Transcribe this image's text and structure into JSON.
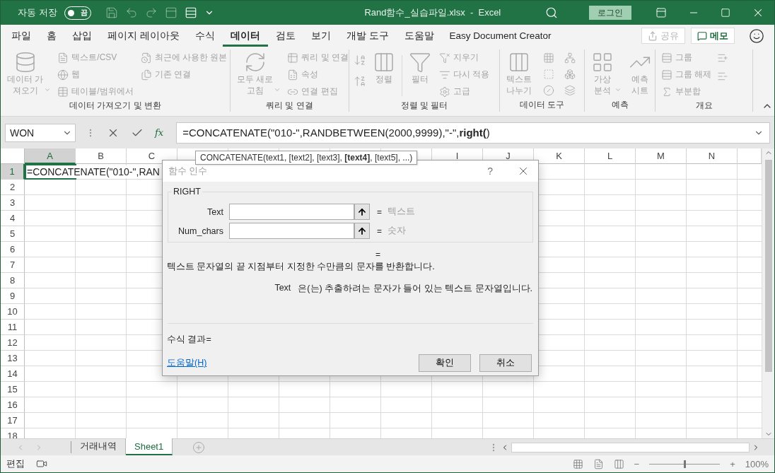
{
  "title_bar": {
    "autosave_label": "자동 저장",
    "autosave_toggle": {
      "on": false,
      "label": "끔"
    },
    "title": "Rand함수_실습파일.xlsx  -  Excel",
    "sign_in": "로그인"
  },
  "ribbon_tabs": [
    {
      "label": "파일",
      "selected": false
    },
    {
      "label": "홈",
      "selected": false
    },
    {
      "label": "삽입",
      "selected": false
    },
    {
      "label": "페이지 레이아웃",
      "selected": false
    },
    {
      "label": "수식",
      "selected": false
    },
    {
      "label": "데이터",
      "selected": true
    },
    {
      "label": "검토",
      "selected": false
    },
    {
      "label": "보기",
      "selected": false
    },
    {
      "label": "개발 도구",
      "selected": false
    },
    {
      "label": "도움말",
      "selected": false
    },
    {
      "label": "Easy Document Creator",
      "selected": false
    }
  ],
  "share_button": {
    "label": "공유",
    "disabled": true
  },
  "comments_button": {
    "label": "메모"
  },
  "ribbon": {
    "disabled": true,
    "groups": [
      {
        "label": "데이터 가져오기 및 변환",
        "items": [
          "데이터 가\n져오기",
          "텍스트/CSV",
          "웹",
          "테이블/범위에서",
          "최근에 사용한 원본",
          "기존 연결"
        ]
      },
      {
        "label": "쿼리 및 연결",
        "items": [
          "모두 새로\n고침",
          "쿼리 및 연결",
          "속성",
          "연결 편집"
        ]
      },
      {
        "label": "정렬 및 필터",
        "items": [
          "정렬",
          "필터",
          "지우기",
          "다시 적용",
          "고급"
        ]
      },
      {
        "label": "데이터 도구",
        "items": [
          "텍스트\n나누기"
        ]
      },
      {
        "label": "예측",
        "items": [
          "가상\n분석",
          "예측\n시트"
        ]
      },
      {
        "label": "개요",
        "items": [
          "그룹",
          "그룹 해제",
          "부분합"
        ]
      }
    ]
  },
  "formula_bar": {
    "name_box": "WON",
    "insert_function": "fx",
    "formula": "=CONCATENATE(\"010-\",RANDBETWEEN(2000,9999),\"-\",**right(**)"
  },
  "tooltip": "CONCATENATE(text1, [text2], [text3], **[text4]**, [text5], ...)",
  "sheet": {
    "columns_left": [
      {
        "label": "A",
        "selected": true
      },
      {
        "label": "B",
        "selected": false
      },
      {
        "label": "C",
        "selected": false
      }
    ],
    "columns_right": [
      {
        "label": "I",
        "selected": false
      },
      {
        "label": "J",
        "selected": false
      },
      {
        "label": "K",
        "selected": false
      },
      {
        "label": "L",
        "selected": false
      },
      {
        "label": "M",
        "selected": false
      },
      {
        "label": "N",
        "selected": false
      }
    ],
    "rows": [
      {
        "label": "1",
        "selected": true
      },
      {
        "label": "2",
        "selected": false
      },
      {
        "label": "3",
        "selected": false
      },
      {
        "label": "4",
        "selected": false
      },
      {
        "label": "5",
        "selected": false
      },
      {
        "label": "6",
        "selected": false
      },
      {
        "label": "7",
        "selected": false
      },
      {
        "label": "8",
        "selected": false
      },
      {
        "label": "9",
        "selected": false
      },
      {
        "label": "10",
        "selected": false
      },
      {
        "label": "11",
        "selected": false
      },
      {
        "label": "12",
        "selected": false
      },
      {
        "label": "13",
        "selected": false
      },
      {
        "label": "14",
        "selected": false
      },
      {
        "label": "15",
        "selected": false
      },
      {
        "label": "16",
        "selected": false
      },
      {
        "label": "17",
        "selected": false
      },
      {
        "label": "18",
        "selected": false
      }
    ],
    "active_cell_text": "=CONCATENATE(\"010-\",RAN"
  },
  "dialog": {
    "title": "함수 인수",
    "help": "?",
    "function_name": "RIGHT",
    "arguments": [
      {
        "label": "Text",
        "equals": "=",
        "value_hint": "텍스트"
      },
      {
        "label": "Num_chars",
        "equals": "=",
        "value_hint": "숫자"
      }
    ],
    "result_equals": "=",
    "description": "텍스트 문자열의 끝 지점부터 지정한 수만큼의 문자를 반환합니다.",
    "argument_help": {
      "name": "Text",
      "text": "은(는) 추출하려는 문자가 들어 있는 텍스트 문자열입니다."
    },
    "formula_result": "수식 결과=",
    "help_link": "도움말(H)",
    "buttons": [
      "확인",
      "취소"
    ]
  },
  "sheet_tabs": [
    {
      "label": "거래내역",
      "selected": false
    },
    {
      "label": "Sheet1",
      "selected": true
    }
  ],
  "status_bar": {
    "mode": "편집",
    "zoom": {
      "minus": "−",
      "plus": "+",
      "level": 0.5,
      "reading": "100%"
    }
  }
}
